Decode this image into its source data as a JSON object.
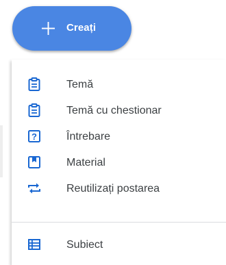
{
  "create_button": {
    "label": "Creați",
    "icon": "plus-icon",
    "color": "#4a86e3"
  },
  "menu": {
    "items": [
      {
        "label": "Temă",
        "icon": "assignment-icon"
      },
      {
        "label": "Temă cu chestionar",
        "icon": "quiz-assignment-icon"
      },
      {
        "label": "Întrebare",
        "icon": "question-icon"
      },
      {
        "label": "Material",
        "icon": "material-icon"
      },
      {
        "label": "Reutilizați postarea",
        "icon": "reuse-post-icon"
      }
    ],
    "extra_items": [
      {
        "label": "Subiect",
        "icon": "topic-icon"
      }
    ],
    "icon_color": "#1967d2"
  }
}
